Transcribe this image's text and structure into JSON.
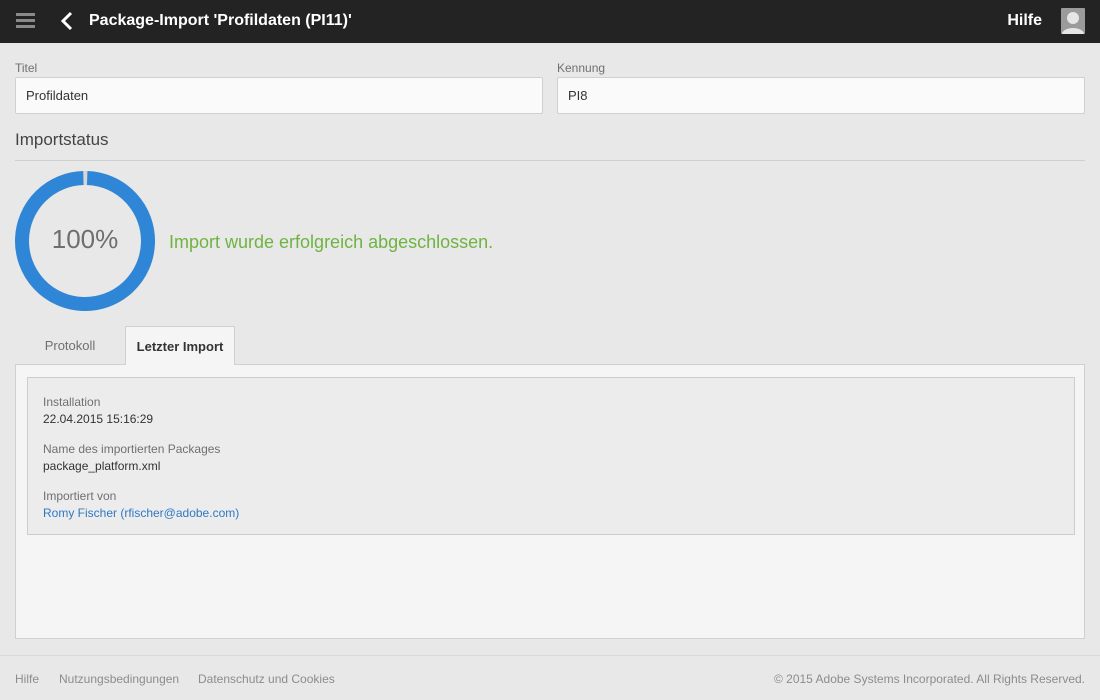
{
  "header": {
    "menu_icon": "hamburger-menu-icon",
    "back_icon": "chevron-left-icon",
    "title": "Package-Import 'Profildaten (PI11)'",
    "help_label": "Hilfe",
    "avatar_icon": "user-avatar-icon"
  },
  "form": {
    "title_label": "Titel",
    "title_value": "Profildaten",
    "id_label": "Kennung",
    "id_value": "PI8"
  },
  "import_status": {
    "heading": "Importstatus",
    "progress_percent": 100,
    "progress_text": "100%",
    "message": "Import wurde erfolgreich abgeschlossen.",
    "ring_color": "#2f86d6",
    "message_color": "#6fb341"
  },
  "tabs": [
    {
      "label": "Protokoll",
      "active": false
    },
    {
      "label": "Letzter Import",
      "active": true
    }
  ],
  "last_import": {
    "installation_label": "Installation",
    "installation_value": "22.04.2015 15:16:29",
    "package_label": "Name des importierten Packages",
    "package_value": "package_platform.xml",
    "imported_by_label": "Importiert von",
    "imported_by_value": "Romy Fischer (rfischer@adobe.com)"
  },
  "footer": {
    "links": [
      "Hilfe",
      "Nutzungsbedingungen",
      "Datenschutz und Cookies"
    ],
    "copyright": "© 2015 Adobe Systems Incorporated. All Rights Reserved."
  }
}
